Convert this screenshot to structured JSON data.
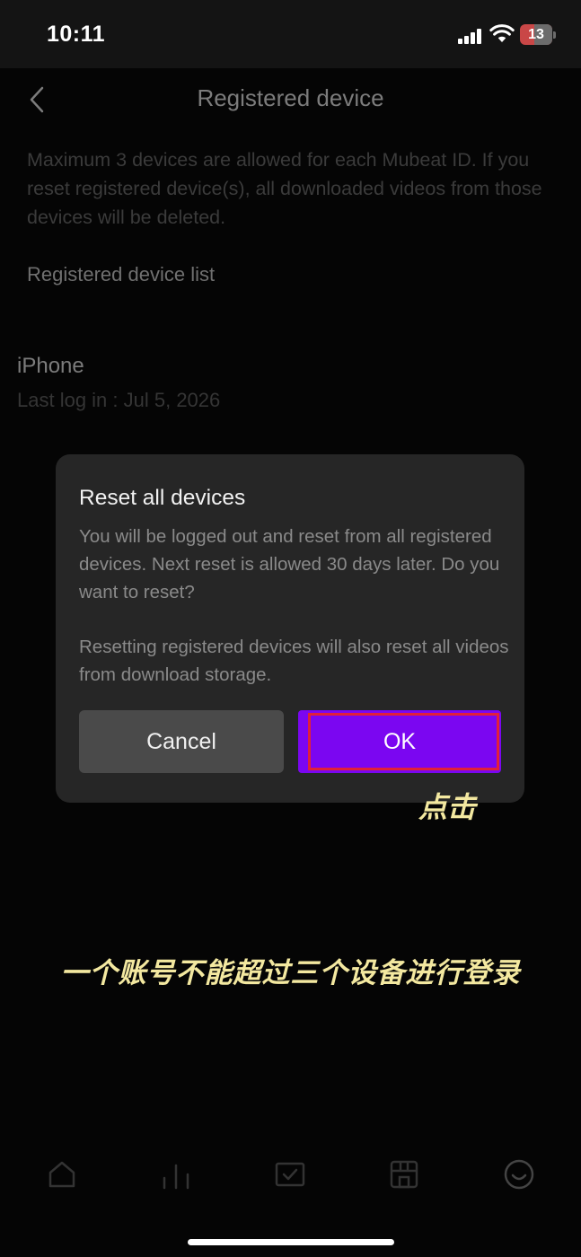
{
  "status_bar": {
    "time": "10:11",
    "battery_level": "13",
    "icons": [
      "cellular-signal-icon",
      "wifi-icon",
      "battery-icon"
    ]
  },
  "header": {
    "title": "Registered device",
    "back_icon": "chevron-left-icon"
  },
  "info": {
    "text": "Maximum 3 devices are allowed for each Mubeat ID. If you reset registered device(s), all downloaded videos from those devices will be deleted."
  },
  "device_list": {
    "label": "Registered device list",
    "items": [
      {
        "name": "iPhone",
        "last_log": "Last log in : Jul 5, 2026"
      }
    ]
  },
  "dialog": {
    "title": "Reset all devices",
    "message_1": "You will be logged out and reset from all registered devices. Next reset is allowed 30 days later. Do you want to reset?",
    "message_2": "Resetting registered devices will also reset all videos from download storage.",
    "cancel_label": "Cancel",
    "ok_label": "OK"
  },
  "annotations": {
    "tap_hint": "点击",
    "caption": "一个账号不能超过三个设备进行登录"
  },
  "tab_bar": {
    "icons": [
      "home-icon",
      "chart-icon",
      "checkbox-icon",
      "store-icon",
      "profile-icon"
    ]
  },
  "colors": {
    "accent": "#7b06f1",
    "highlight": "#e0203a",
    "annotation": "#f3e8a0",
    "battery_low": "#c94747"
  }
}
